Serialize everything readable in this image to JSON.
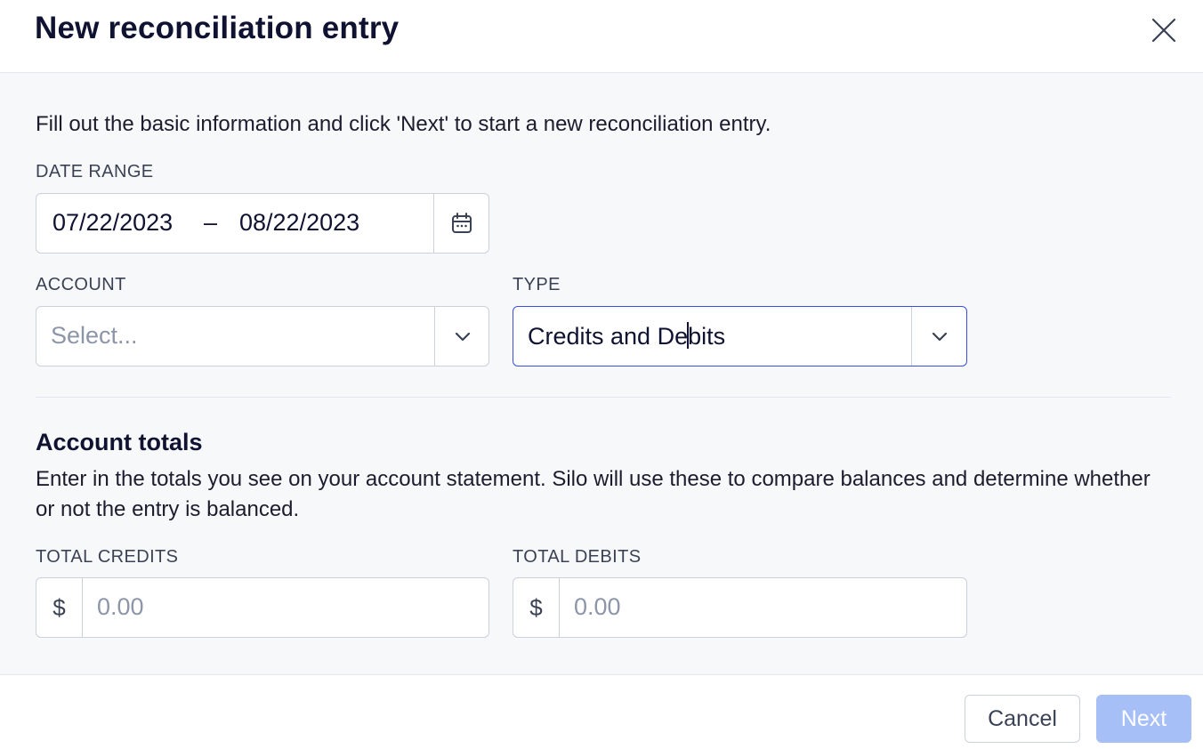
{
  "dialog": {
    "title": "New reconciliation entry"
  },
  "intro": "Fill out the basic information and click 'Next' to start a new reconciliation entry.",
  "date_range": {
    "label": "DATE RANGE",
    "start": "07/22/2023",
    "separator": "–",
    "end": "08/22/2023",
    "icon": "calendar-icon"
  },
  "account": {
    "label": "ACCOUNT",
    "placeholder": "Select...",
    "icon": "chevron-down-icon"
  },
  "type": {
    "label": "TYPE",
    "value_before_cursor": "Credits and De",
    "value_after_cursor": "bits",
    "icon": "chevron-down-icon"
  },
  "account_totals": {
    "title": "Account totals",
    "description": "Enter in the totals you see on your account statement. Silo will use these to compare balances and determine whether or not the entry is balanced.",
    "total_credits": {
      "label": "TOTAL CREDITS",
      "prefix": "$",
      "placeholder": "0.00"
    },
    "total_debits": {
      "label": "TOTAL DEBITS",
      "prefix": "$",
      "placeholder": "0.00"
    }
  },
  "footer": {
    "cancel_label": "Cancel",
    "next_label": "Next"
  },
  "colors": {
    "focus_border": "#3a4fe0",
    "next_disabled_bg": "#a7bff7",
    "body_bg": "#f7f8fa"
  }
}
